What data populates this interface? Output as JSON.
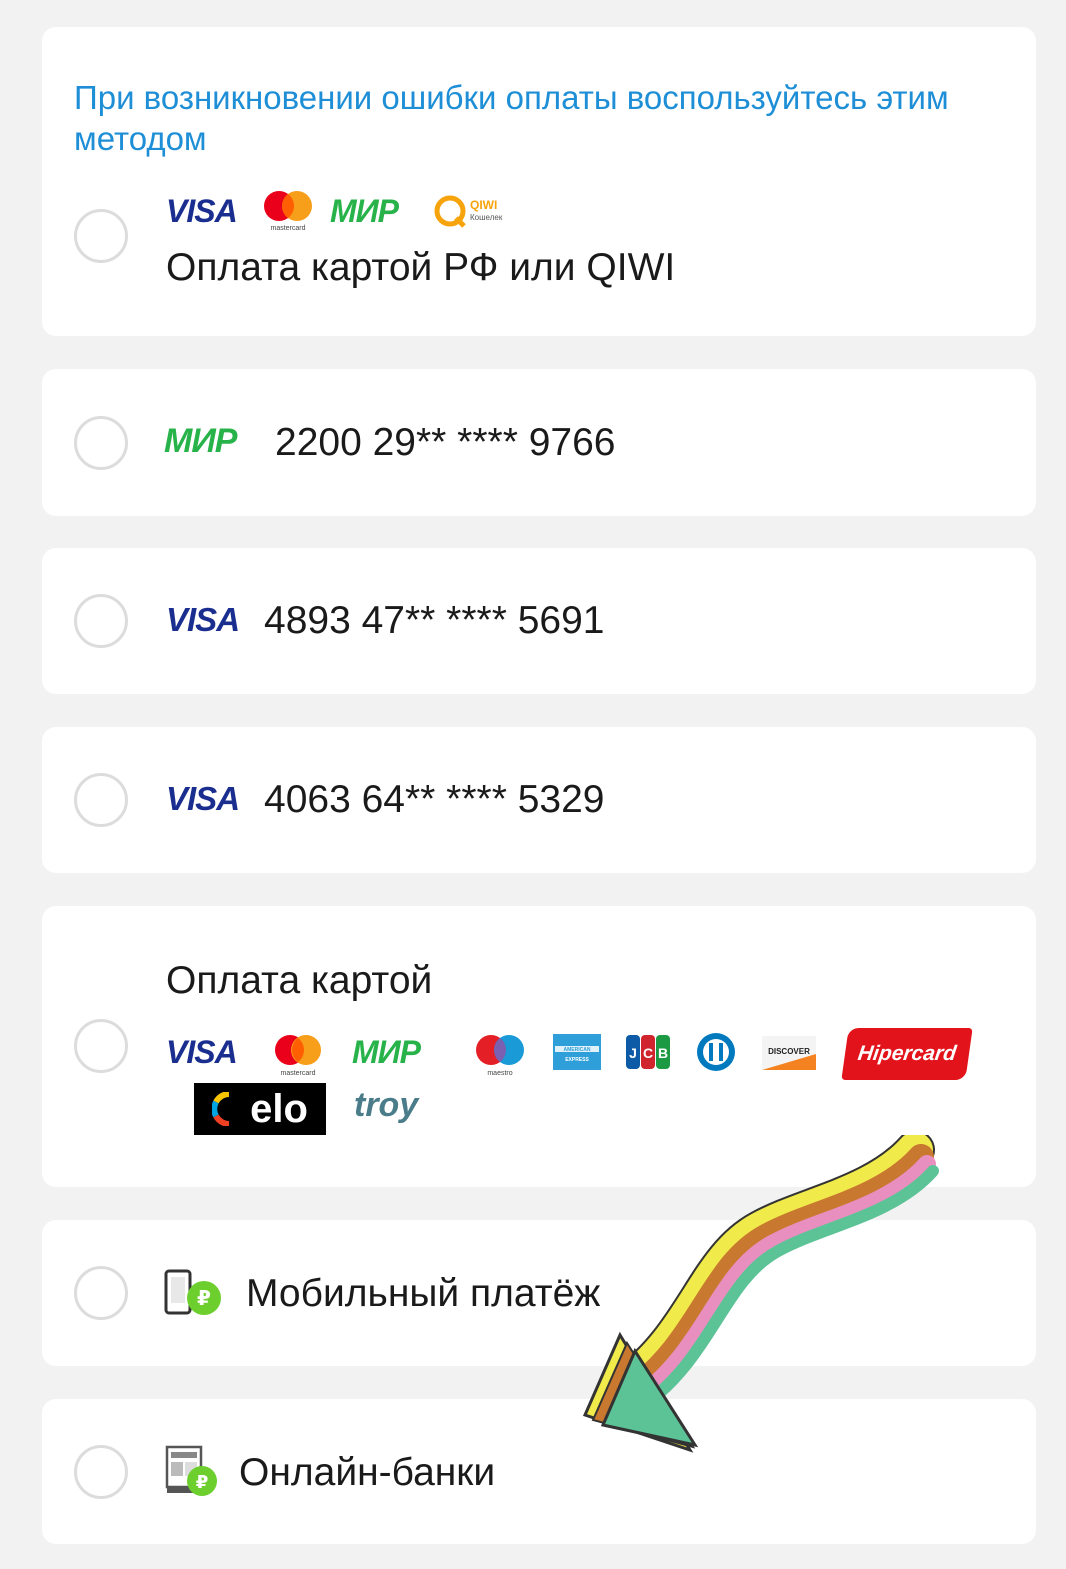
{
  "notice": {
    "text": "При возникновении ошибки оплаты воспользуйтесь этим методом"
  },
  "methods": [
    {
      "label": "Оплата картой РФ или QIWI",
      "logos": [
        "visa",
        "mastercard",
        "mir",
        "qiwi"
      ],
      "logo_text": {
        "visa": "VISA",
        "mastercard_caption": "mastercard",
        "mir": "МИР",
        "qiwi": "QIWI",
        "qiwi_caption": "Кошелек"
      }
    },
    {
      "label": "2200 29** **** 9766",
      "logos": [
        "mir"
      ],
      "logo_text": {
        "mir": "МИР"
      }
    },
    {
      "label": "4893 47** **** 5691",
      "logos": [
        "visa"
      ],
      "logo_text": {
        "visa": "VISA"
      }
    },
    {
      "label": "4063 64** **** 5329",
      "logos": [
        "visa"
      ],
      "logo_text": {
        "visa": "VISA"
      }
    },
    {
      "label": "Оплата картой",
      "logos": [
        "visa",
        "mastercard",
        "mir",
        "maestro",
        "american-express",
        "jcb",
        "diners-club",
        "discover",
        "hipercard",
        "elo",
        "troy"
      ],
      "logo_text": {
        "visa": "VISA",
        "mastercard_caption": "mastercard",
        "mir": "МИР",
        "maestro_caption": "maestro",
        "amex": "AMERICAN EXPRESS",
        "jcb": "JCB",
        "discover": "DISCOVER",
        "hipercard": "Hipercard",
        "elo": "elo",
        "troy": "troy"
      }
    },
    {
      "label": "Мобильный платёж",
      "logos": [
        "mobile-payment-icon"
      ]
    },
    {
      "label": "Онлайн-банки",
      "logos": [
        "online-bank-icon"
      ]
    }
  ],
  "colors": {
    "hint": "#1e8fd6",
    "visa": "#1a2e8f",
    "mir": "#27b34a",
    "card_bg": "#ffffff",
    "page_bg": "#f2f2f2",
    "arrow_stripes": [
      "#f1ea4b",
      "#c8782f",
      "#e98fbf",
      "#5cc397"
    ]
  }
}
